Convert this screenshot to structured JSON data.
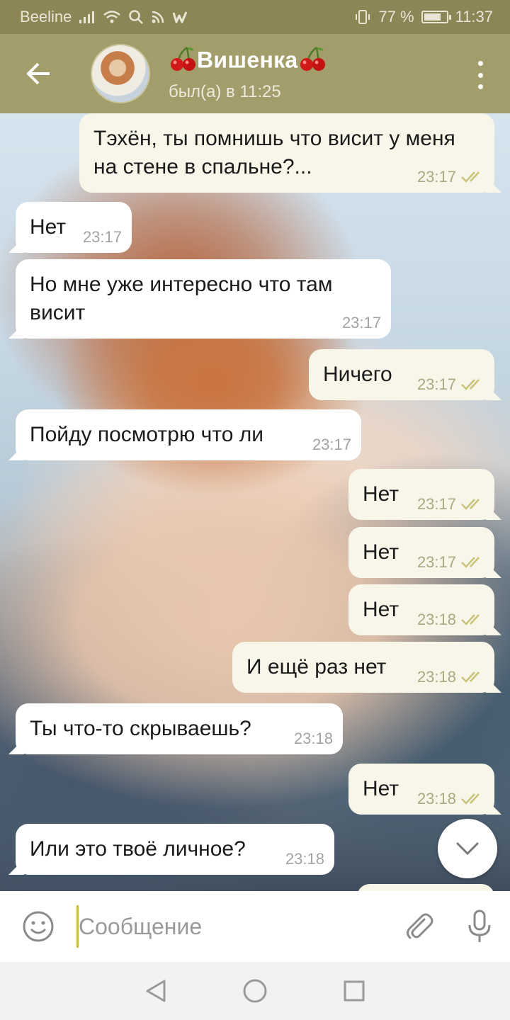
{
  "status_bar": {
    "carrier": "Beeline",
    "battery": "77 %",
    "battery_fraction": 0.77,
    "time": "11:37"
  },
  "header": {
    "back_icon": "arrow-left-icon",
    "name": "Вишенка",
    "name_decoration_icon": "cherry-icon",
    "status": "был(а) в 11:25",
    "menu_icon": "more-vertical-icon"
  },
  "messages": [
    {
      "dir": "out",
      "text": "Тэхён, ты помнишь что висит у меня на стене в спальне?...",
      "time": "23:17",
      "read": true
    },
    {
      "dir": "in",
      "text": "Нет",
      "time": "23:17"
    },
    {
      "dir": "in",
      "text": "Но мне уже интересно что там висит",
      "time": "23:17"
    },
    {
      "dir": "out",
      "text": "Ничего",
      "time": "23:17",
      "read": true
    },
    {
      "dir": "in",
      "text": "Пойду посмотрю что ли",
      "time": "23:17"
    },
    {
      "dir": "out",
      "text": "Нет",
      "time": "23:17",
      "read": true
    },
    {
      "dir": "out",
      "text": "Нет",
      "time": "23:17",
      "read": true
    },
    {
      "dir": "out",
      "text": "Нет",
      "time": "23:18",
      "read": true
    },
    {
      "dir": "out",
      "text": "И ещё раз нет",
      "time": "23:18",
      "read": true
    },
    {
      "dir": "in",
      "text": "Ты что-то скрываешь?",
      "time": "23:18"
    },
    {
      "dir": "out",
      "text": "Нет",
      "time": "23:18",
      "read": true
    },
    {
      "dir": "in",
      "text": "Или это твоё личное?",
      "time": "23:18"
    }
  ],
  "composer": {
    "emoji_icon": "emoji-icon",
    "placeholder": "Сообщение",
    "attach_icon": "paperclip-icon",
    "mic_icon": "microphone-icon"
  },
  "scroll_down_icon": "chevron-down-icon",
  "nav": {
    "back_icon": "triangle-back-icon",
    "home_icon": "circle-home-icon",
    "recents_icon": "square-recents-icon"
  },
  "colors": {
    "status_bar": "#8c8556",
    "header": "#a29d6b",
    "outgoing_bubble": "#f7f6e9",
    "incoming_bubble": "#ffffff",
    "read_check": "#c9c37a",
    "cursor": "#c9b845"
  }
}
